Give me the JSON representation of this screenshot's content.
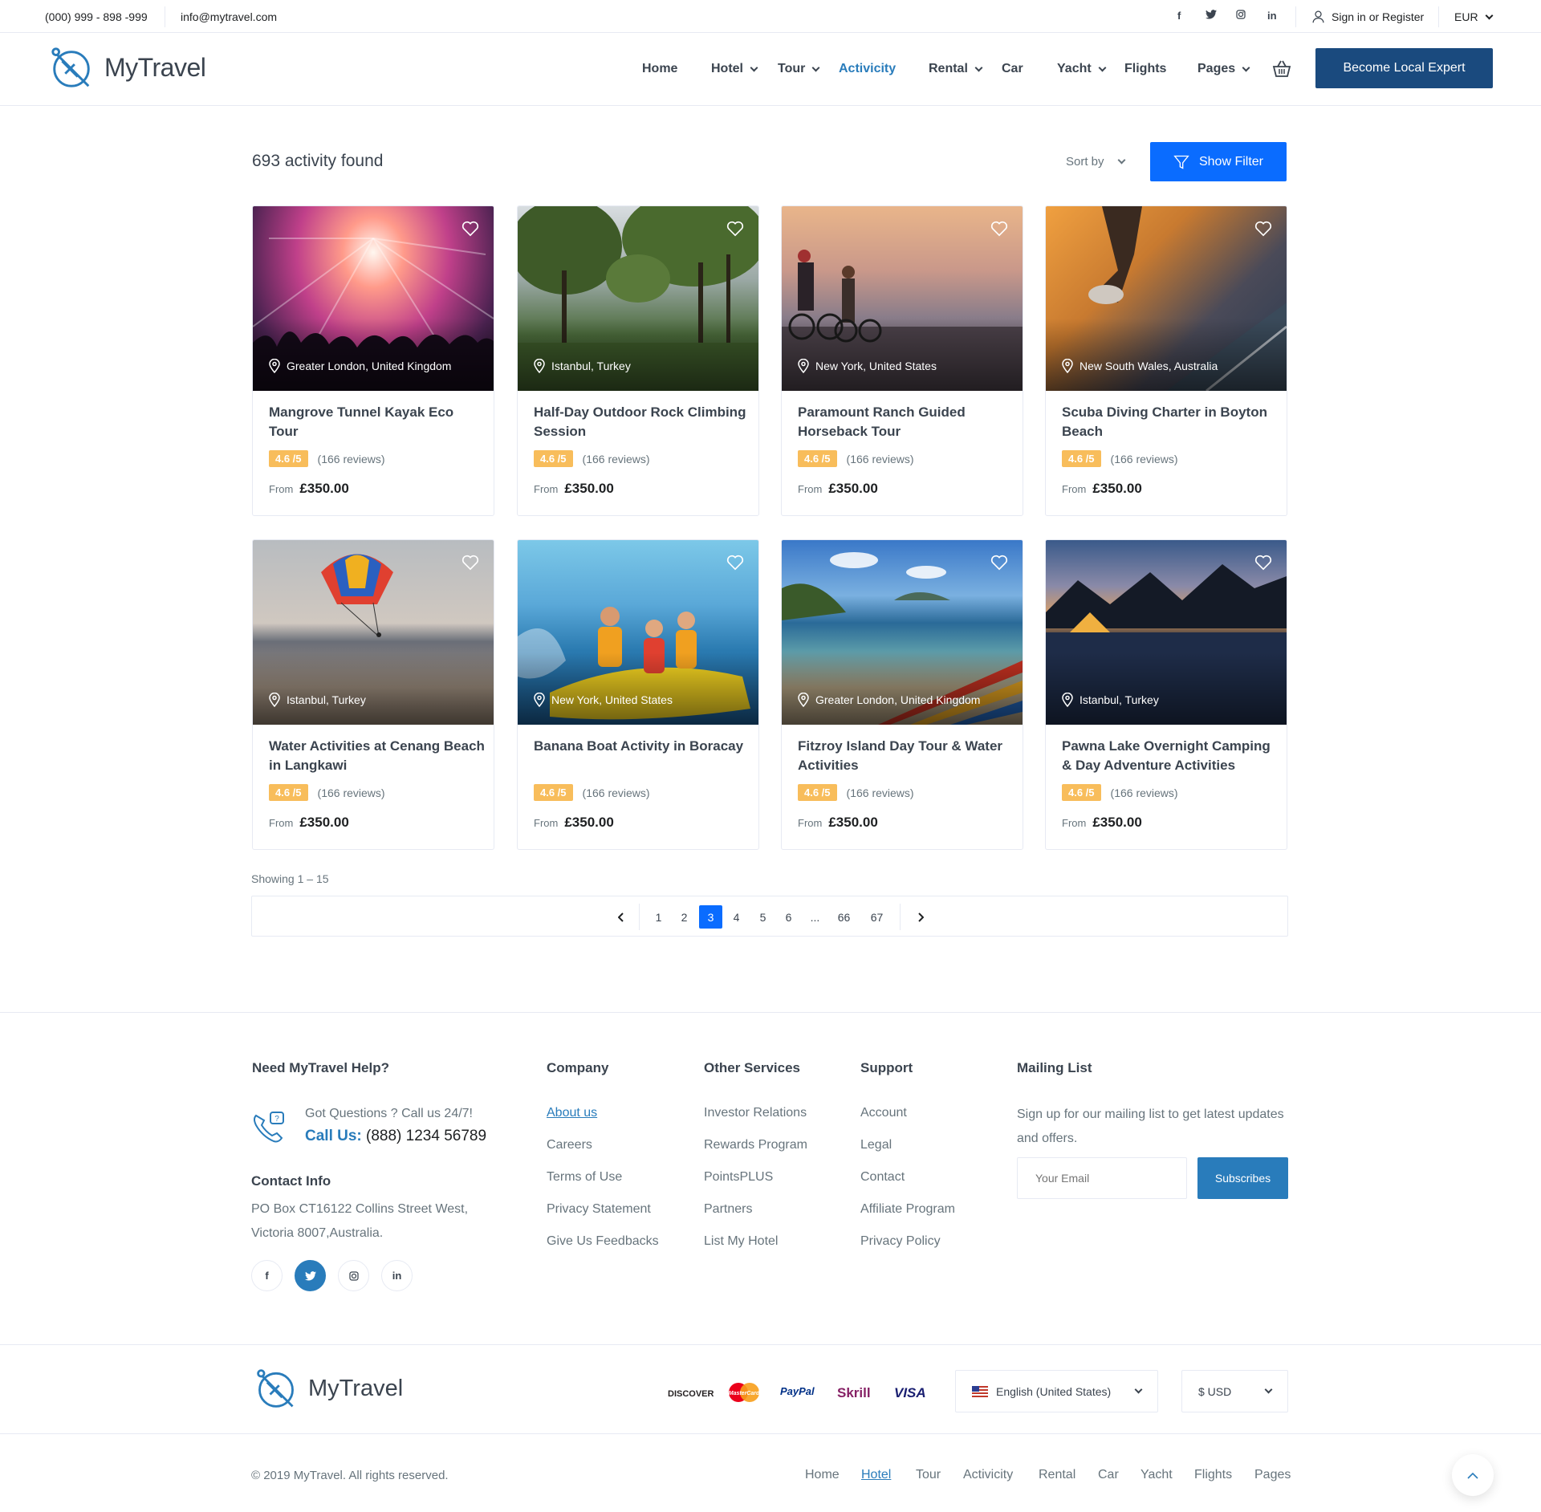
{
  "topbar": {
    "phone": "(000) 999 - 898 -999",
    "email": "info@mytravel.com",
    "social": [
      {
        "icon": "facebook-icon",
        "glyph": "f"
      },
      {
        "icon": "twitter-icon",
        "glyph": "🐦"
      },
      {
        "icon": "instagram-icon",
        "glyph": "◎"
      },
      {
        "icon": "linkedin-icon",
        "glyph": "in"
      }
    ],
    "signin": "Sign in or Register",
    "currency": "EUR"
  },
  "header": {
    "logo_text": "MyTravel",
    "nav": [
      {
        "label": "Home",
        "dropdown": false,
        "active": false
      },
      {
        "label": "Hotel",
        "dropdown": true,
        "active": false
      },
      {
        "label": "Tour",
        "dropdown": true,
        "active": false
      },
      {
        "label": "Activicity",
        "dropdown": false,
        "active": true
      },
      {
        "label": "Rental",
        "dropdown": true,
        "active": false
      },
      {
        "label": "Car",
        "dropdown": false,
        "active": false
      },
      {
        "label": "Yacht",
        "dropdown": true,
        "active": false
      },
      {
        "label": "Flights",
        "dropdown": false,
        "active": false
      },
      {
        "label": "Pages",
        "dropdown": true,
        "active": false
      }
    ],
    "cta": "Become Local Expert"
  },
  "results": {
    "title": "693 activity found",
    "sort_label": "Sort by",
    "filter_label": "Show Filter"
  },
  "cards": [
    {
      "location": "Greater London, United Kingdom",
      "title": "Mangrove Tunnel Kayak Eco Tour",
      "rating": "4.6 /5",
      "reviews": "(166 reviews)",
      "from": "From",
      "price": "£350.00"
    },
    {
      "location": "Istanbul, Turkey",
      "title": "Half-Day Outdoor Rock Climbing Session",
      "rating": "4.6 /5",
      "reviews": "(166 reviews)",
      "from": "From",
      "price": "£350.00"
    },
    {
      "location": "New York, United States",
      "title": "Paramount Ranch Guided Horseback Tour",
      "rating": "4.6 /5",
      "reviews": "(166 reviews)",
      "from": "From",
      "price": "£350.00"
    },
    {
      "location": "New South Wales, Australia",
      "title": "Scuba Diving Charter in Boyton Beach",
      "rating": "4.6 /5",
      "reviews": "(166 reviews)",
      "from": "From",
      "price": "£350.00"
    },
    {
      "location": "Istanbul, Turkey",
      "title": "Water Activities at Cenang Beach in Langkawi",
      "rating": "4.6 /5",
      "reviews": "(166 reviews)",
      "from": "From",
      "price": "£350.00"
    },
    {
      "location": "New York, United States",
      "title": "Banana Boat Activity in Boracay",
      "rating": "4.6 /5",
      "reviews": "(166 reviews)",
      "from": "From",
      "price": "£350.00"
    },
    {
      "location": "Greater London, United Kingdom",
      "title": "Fitzroy Island Day Tour & Water Activities",
      "rating": "4.6 /5",
      "reviews": "(166 reviews)",
      "from": "From",
      "price": "£350.00"
    },
    {
      "location": "Istanbul, Turkey",
      "title": "Pawna Lake Overnight Camping & Day Adventure Activities",
      "rating": "4.6 /5",
      "reviews": "(166 reviews)",
      "from": "From",
      "price": "£350.00"
    }
  ],
  "pagination": {
    "showing": "Showing 1 – 15",
    "pages": [
      "1",
      "2",
      "3",
      "4",
      "5",
      "6",
      "...",
      "66",
      "67"
    ],
    "current": "3"
  },
  "footer": {
    "help": {
      "title": "Need MyTravel Help?",
      "question": "Got Questions ? Call us 24/7!",
      "call_label": "Call Us:",
      "call_number": "(888) 1234 56789",
      "contact_title": "Contact Info",
      "address": "PO Box CT16122 Collins Street West, Victoria 8007,Australia."
    },
    "social": [
      {
        "icon": "facebook-icon",
        "glyph": "f"
      },
      {
        "icon": "twitter-icon",
        "glyph": "🐦"
      },
      {
        "icon": "instagram-icon",
        "glyph": "◎"
      },
      {
        "icon": "linkedin-icon",
        "glyph": "in"
      }
    ],
    "company": {
      "title": "Company",
      "links": [
        "About us",
        "Careers",
        "Terms of Use",
        "Privacy Statement",
        "Give Us Feedbacks"
      ]
    },
    "services": {
      "title": "Other Services",
      "links": [
        "Investor Relations",
        "Rewards Program",
        "PointsPLUS",
        "Partners",
        "List My Hotel"
      ]
    },
    "support": {
      "title": "Support",
      "links": [
        "Account",
        "Legal",
        "Contact",
        "Affiliate Program",
        "Privacy Policy"
      ]
    },
    "mailing": {
      "title": "Mailing List",
      "desc": "Sign up for our mailing list to get latest updates and offers.",
      "placeholder": "Your Email",
      "button": "Subscribes"
    },
    "logo_text": "MyTravel",
    "payments": [
      {
        "label": "DISCOVER",
        "color": "#231f20"
      },
      {
        "label": "MasterCard",
        "color": "#eb001b"
      },
      {
        "label": "PayPal",
        "color": "#003087"
      },
      {
        "label": "Skrill",
        "color": "#862165"
      },
      {
        "label": "VISA",
        "color": "#1a1f71"
      }
    ],
    "language": "English (United States)",
    "currency": "$ USD",
    "copyright": "© 2019 MyTravel. All rights reserved.",
    "bottom_nav": [
      "Home",
      "Hotel",
      "Tour",
      "Activicity",
      "Rental",
      "Car",
      "Yacht",
      "Flights",
      "Pages"
    ],
    "bottom_active": "Hotel"
  },
  "colors": {
    "primary": "#297cbb",
    "button_blue": "#0a6cff",
    "cta_navy": "#1a4a7e",
    "rating_badge": "#f8bd5b"
  }
}
